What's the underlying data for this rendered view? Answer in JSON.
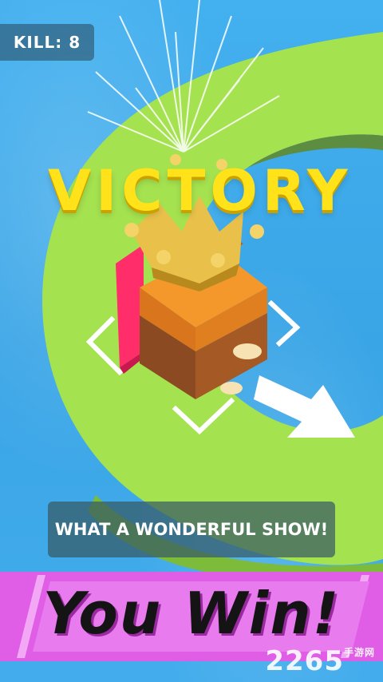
{
  "hud": {
    "kill_label": "KILL: 8"
  },
  "title": "VICTORY",
  "message": "WHAT A WONDERFUL SHOW!",
  "banner": "You Win!",
  "watermark": {
    "text": "2265",
    "suffix": "手游网"
  },
  "colors": {
    "water": "#3ea9e8",
    "island": "#9fe04a",
    "victory_text": "#ffe21a",
    "banner": "#e05ee6",
    "crate": "#f0902a"
  },
  "icons": [
    "crown-icon",
    "arrow-icon",
    "target-corner-icon"
  ]
}
